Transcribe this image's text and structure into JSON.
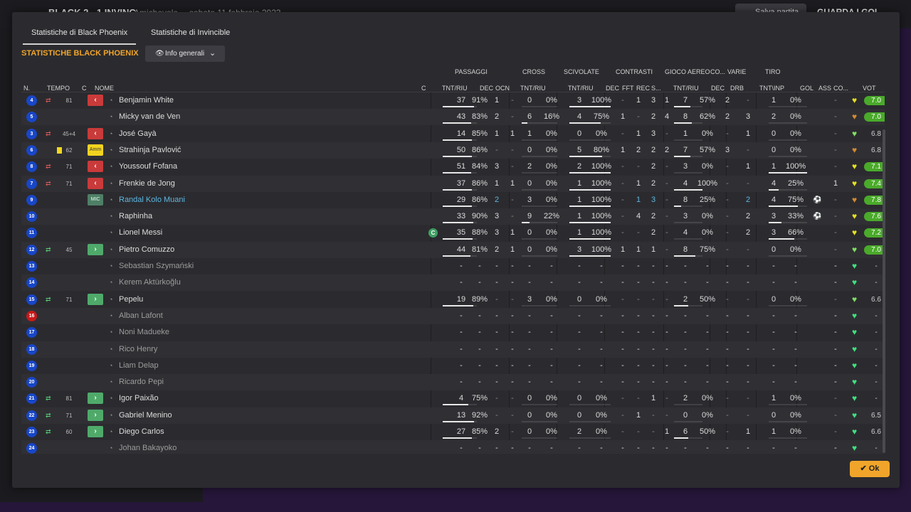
{
  "background": {
    "back": "←",
    "match": "BLACK  2 - 1  INVINC",
    "competition": "Amichevole",
    "date": "sabato 11 febbraio 2023",
    "save_label": "Salva partita",
    "watch_label": "GUARDA I GOL"
  },
  "tabs": [
    "Statistiche di Black Phoenix",
    "Statistiche di Invincible"
  ],
  "team_title": "STATISTICHE BLACK PHOENIX",
  "dropdown": {
    "label": "Info generali",
    "eye": "👁",
    "chevron": "⌄"
  },
  "groups": {
    "passaggi": "PASSAGGI",
    "cross": "CROSS",
    "scivolate": "SCIVOLATE",
    "contrasti": "CONTRASTI",
    "gioco_aereo": "GIOCO AEREO",
    "co": "CO...",
    "varie": "VARIE",
    "tiro": "TIRO"
  },
  "columns": {
    "n": "N.",
    "tempo": "TEMPO",
    "c": "C",
    "nome": "NOME",
    "c2": "C",
    "pass_tnt": "TNT/RIU",
    "pass_dec": "DEC",
    "pass_ocn": "OCN",
    "cross_tnt": "TNT/RIU",
    "sciv_tnt": "TNT/RIU",
    "con_dec": "DEC",
    "con_fft": "FFT",
    "con_rec": "REC",
    "con_s": "S...",
    "aereo_tnt": "TNT/RIU",
    "co_dec": "DEC",
    "varie_drb": "DRB",
    "tiro_tnt": "TNT\\INP",
    "gol": "GOL",
    "ass": "ASS",
    "con2": "CO...",
    "vot": "VOT"
  },
  "icons": {
    "sub_out": "⇄",
    "sub_in": "⇄",
    "out_badge": "‹",
    "in_badge": "›",
    "head": "◔",
    "heart": "♥",
    "gol": "⚽",
    "captain": "C"
  },
  "players": [
    {
      "n": "4",
      "num_color": "blue",
      "sub": "out",
      "min": "81",
      "badge": "out",
      "name": "Benjamin White",
      "style": "",
      "p": "37",
      "pp": "91%",
      "pbar": 0.91,
      "pd": "1",
      "po": "-",
      "c": "0",
      "cp": "0%",
      "cbar": 0,
      "s": "3",
      "sp": "100%",
      "sbar": 1,
      "k1": "-",
      "k2": "1",
      "k3": "3",
      "k4": "1",
      "a": "7",
      "ap": "57%",
      "abar": 0.57,
      "cd": "2",
      "dr": "-",
      "t": "1",
      "tp": "0%",
      "tbar": 0,
      "gol": "",
      "as": "-",
      "heart": "#e6e020",
      "vot": "7.0",
      "vg": true
    },
    {
      "n": "5",
      "num_color": "blue",
      "sub": "",
      "min": "",
      "badge": "",
      "name": "Micky van de Ven",
      "style": "",
      "p": "43",
      "pp": "83%",
      "pbar": 0.83,
      "pd": "2",
      "po": "-",
      "c": "6",
      "cp": "16%",
      "cbar": 0.16,
      "s": "4",
      "sp": "75%",
      "sbar": 0.75,
      "k1": "1",
      "k2": "-",
      "k3": "2",
      "k4": "4",
      "a": "8",
      "ap": "62%",
      "abar": 0.62,
      "cd": "2",
      "dr": "3",
      "t": "2",
      "tp": "0%",
      "tbar": 0,
      "gol": "",
      "as": "-",
      "heart": "#d48a30",
      "vot": "7.0",
      "vg": true
    },
    {
      "n": "3",
      "num_color": "blue",
      "sub": "out",
      "min": "45+4",
      "badge": "out",
      "name": "José Gayà",
      "style": "",
      "p": "14",
      "pp": "85%",
      "pbar": 0.85,
      "pd": "1",
      "po": "1",
      "c": "1",
      "cp": "0%",
      "cbar": 0,
      "s": "0",
      "sp": "0%",
      "sbar": 0,
      "k1": "-",
      "k2": "1",
      "k3": "3",
      "k4": "-",
      "a": "1",
      "ap": "0%",
      "abar": 0,
      "cd": "-",
      "dr": "1",
      "t": "0",
      "tp": "0%",
      "tbar": 0,
      "gol": "",
      "as": "-",
      "heart": "#7ee060",
      "vot": "6.8",
      "vg": false
    },
    {
      "n": "6",
      "num_color": "blue",
      "sub": "yellow",
      "min": "62",
      "badge": "amm",
      "name": "Strahinja Pavlović",
      "style": "",
      "p": "50",
      "pp": "86%",
      "pbar": 0.86,
      "pd": "-",
      "po": "-",
      "c": "0",
      "cp": "0%",
      "cbar": 0,
      "s": "5",
      "sp": "80%",
      "sbar": 0.8,
      "k1": "1",
      "k2": "2",
      "k3": "2",
      "k4": "2",
      "a": "7",
      "ap": "57%",
      "abar": 0.57,
      "cd": "3",
      "dr": "-",
      "t": "0",
      "tp": "0%",
      "tbar": 0,
      "gol": "",
      "as": "-",
      "heart": "#d48a30",
      "vot": "6.8",
      "vg": false
    },
    {
      "n": "8",
      "num_color": "blue",
      "sub": "out",
      "min": "71",
      "badge": "out",
      "name": "Youssouf Fofana",
      "style": "",
      "p": "51",
      "pp": "84%",
      "pbar": 0.84,
      "pd": "3",
      "po": "-",
      "c": "2",
      "cp": "0%",
      "cbar": 0,
      "s": "2",
      "sp": "100%",
      "sbar": 1,
      "k1": "-",
      "k2": "-",
      "k3": "2",
      "k4": "-",
      "a": "3",
      "ap": "0%",
      "abar": 0,
      "cd": "-",
      "dr": "1",
      "t": "1",
      "tp": "100%",
      "tbar": 1,
      "gol": "",
      "as": "-",
      "heart": "#e6e020",
      "vot": "7.1",
      "vg": true
    },
    {
      "n": "7",
      "num_color": "blue",
      "sub": "out",
      "min": "71",
      "badge": "out",
      "name": "Frenkie de Jong",
      "style": "",
      "p": "37",
      "pp": "86%",
      "pbar": 0.86,
      "pd": "1",
      "po": "1",
      "c": "0",
      "cp": "0%",
      "cbar": 0,
      "s": "1",
      "sp": "100%",
      "sbar": 1,
      "k1": "-",
      "k2": "1",
      "k3": "2",
      "k4": "-",
      "a": "4",
      "ap": "100%",
      "abar": 1,
      "cd": "-",
      "dr": "-",
      "t": "4",
      "tp": "25%",
      "tbar": 0.25,
      "gol": "",
      "as": "1",
      "heart": "#e6e020",
      "vot": "7.4",
      "vg": true
    },
    {
      "n": "9",
      "num_color": "blue",
      "sub": "",
      "min": "",
      "badge": "mic",
      "name": "Randal Kolo Muani",
      "style": "hl",
      "p": "29",
      "pp": "86%",
      "pbar": 0.86,
      "pd": "2",
      "po": "-",
      "c": "3",
      "cp": "0%",
      "cbar": 0,
      "s": "1",
      "sp": "100%",
      "sbar": 1,
      "k1": "-",
      "k2": "1",
      "k3": "3",
      "k4": "-",
      "a": "8",
      "ap": "25%",
      "abar": 0.25,
      "cd": "-",
      "dr": "2",
      "t": "4",
      "tp": "75%",
      "tbar": 0.75,
      "gol": "⚽",
      "as": "-",
      "heart": "#d48a30",
      "vot": "7.8",
      "vg": true
    },
    {
      "n": "10",
      "num_color": "blue",
      "sub": "",
      "min": "",
      "badge": "",
      "name": "Raphinha",
      "style": "",
      "p": "33",
      "pp": "90%",
      "pbar": 0.9,
      "pd": "3",
      "po": "-",
      "c": "9",
      "cp": "22%",
      "cbar": 0.22,
      "s": "1",
      "sp": "100%",
      "sbar": 1,
      "k1": "-",
      "k2": "4",
      "k3": "2",
      "k4": "-",
      "a": "3",
      "ap": "0%",
      "abar": 0,
      "cd": "-",
      "dr": "2",
      "t": "3",
      "tp": "33%",
      "tbar": 0.33,
      "gol": "⚽",
      "as": "-",
      "heart": "#e6e020",
      "vot": "7.6",
      "vg": true
    },
    {
      "n": "11",
      "num_color": "blue",
      "sub": "",
      "min": "",
      "badge": "",
      "name": "Lionel Messi",
      "style": "",
      "captain": true,
      "p": "35",
      "pp": "88%",
      "pbar": 0.88,
      "pd": "3",
      "po": "1",
      "c": "0",
      "cp": "0%",
      "cbar": 0,
      "s": "1",
      "sp": "100%",
      "sbar": 1,
      "k1": "-",
      "k2": "-",
      "k3": "2",
      "k4": "-",
      "a": "4",
      "ap": "0%",
      "abar": 0,
      "cd": "-",
      "dr": "2",
      "t": "3",
      "tp": "66%",
      "tbar": 0.66,
      "gol": "",
      "as": "-",
      "heart": "#e6e020",
      "vot": "7.2",
      "vg": true
    },
    {
      "n": "12",
      "num_color": "blue",
      "sub": "in",
      "min": "45",
      "badge": "in",
      "name": "Pietro Comuzzo",
      "style": "",
      "p": "44",
      "pp": "81%",
      "pbar": 0.81,
      "pd": "2",
      "po": "1",
      "c": "0",
      "cp": "0%",
      "cbar": 0,
      "s": "3",
      "sp": "100%",
      "sbar": 1,
      "k1": "1",
      "k2": "1",
      "k3": "1",
      "k4": "-",
      "a": "8",
      "ap": "75%",
      "abar": 0.75,
      "cd": "-",
      "dr": "-",
      "t": "0",
      "tp": "0%",
      "tbar": 0,
      "gol": "",
      "as": "-",
      "heart": "#7ee060",
      "vot": "7.0",
      "vg": true
    },
    {
      "n": "13",
      "num_color": "blue",
      "sub": "",
      "min": "",
      "badge": "",
      "name": "Sebastian Szymański",
      "style": "dim",
      "empty": true,
      "heart": "#3fe080",
      "vot": "-",
      "vg": false
    },
    {
      "n": "14",
      "num_color": "blue",
      "sub": "",
      "min": "",
      "badge": "",
      "name": "Kerem Aktürkoğlu",
      "style": "dim",
      "empty": true,
      "heart": "#3fe080",
      "vot": "-",
      "vg": false
    },
    {
      "n": "15",
      "num_color": "blue",
      "sub": "in",
      "min": "71",
      "badge": "in",
      "name": "Pepelu",
      "style": "",
      "p": "19",
      "pp": "89%",
      "pbar": 0.89,
      "pd": "-",
      "po": "-",
      "c": "3",
      "cp": "0%",
      "cbar": 0,
      "s": "0",
      "sp": "0%",
      "sbar": 0,
      "k1": "-",
      "k2": "-",
      "k3": "-",
      "k4": "-",
      "a": "2",
      "ap": "50%",
      "abar": 0.5,
      "cd": "-",
      "dr": "-",
      "t": "0",
      "tp": "0%",
      "tbar": 0,
      "gol": "",
      "as": "-",
      "heart": "#7ee060",
      "vot": "6.6",
      "vg": false
    },
    {
      "n": "16",
      "num_color": "red",
      "sub": "",
      "min": "",
      "badge": "",
      "name": "Alban Lafont",
      "style": "dim",
      "empty": true,
      "heart": "#3fe080",
      "vot": "-",
      "vg": false
    },
    {
      "n": "17",
      "num_color": "blue",
      "sub": "",
      "min": "",
      "badge": "",
      "name": "Noni Madueke",
      "style": "dim",
      "empty": true,
      "heart": "#3fe080",
      "vot": "-",
      "vg": false
    },
    {
      "n": "18",
      "num_color": "blue",
      "sub": "",
      "min": "",
      "badge": "",
      "name": "Rico Henry",
      "style": "dim",
      "empty": true,
      "heart": "#3fe080",
      "vot": "-",
      "vg": false
    },
    {
      "n": "19",
      "num_color": "blue",
      "sub": "",
      "min": "",
      "badge": "",
      "name": "Liam Delap",
      "style": "dim",
      "empty": true,
      "heart": "#3fe080",
      "vot": "-",
      "vg": false
    },
    {
      "n": "20",
      "num_color": "blue",
      "sub": "",
      "min": "",
      "badge": "",
      "name": "Ricardo Pepi",
      "style": "dim",
      "empty": true,
      "heart": "#3fe080",
      "vot": "-",
      "vg": false
    },
    {
      "n": "21",
      "num_color": "blue",
      "sub": "in",
      "min": "81",
      "badge": "in",
      "name": "Igor Paixão",
      "style": "",
      "p": "4",
      "pp": "75%",
      "pbar": 0.75,
      "pd": "-",
      "po": "-",
      "c": "0",
      "cp": "0%",
      "cbar": 0,
      "s": "0",
      "sp": "0%",
      "sbar": 0,
      "k1": "-",
      "k2": "-",
      "k3": "1",
      "k4": "-",
      "a": "2",
      "ap": "0%",
      "abar": 0,
      "cd": "-",
      "dr": "-",
      "t": "1",
      "tp": "0%",
      "tbar": 0,
      "gol": "",
      "as": "-",
      "heart": "#3fe080",
      "vot": "-",
      "vg": false
    },
    {
      "n": "22",
      "num_color": "blue",
      "sub": "in",
      "min": "71",
      "badge": "in",
      "name": "Gabriel Menino",
      "style": "",
      "p": "13",
      "pp": "92%",
      "pbar": 0.92,
      "pd": "-",
      "po": "-",
      "c": "0",
      "cp": "0%",
      "cbar": 0,
      "s": "0",
      "sp": "0%",
      "sbar": 0,
      "k1": "-",
      "k2": "1",
      "k3": "-",
      "k4": "-",
      "a": "0",
      "ap": "0%",
      "abar": 0,
      "cd": "-",
      "dr": "-",
      "t": "0",
      "tp": "0%",
      "tbar": 0,
      "gol": "",
      "as": "-",
      "heart": "#3fe080",
      "vot": "6.5",
      "vg": false
    },
    {
      "n": "23",
      "num_color": "blue",
      "sub": "in",
      "min": "60",
      "badge": "in",
      "name": "Diego Carlos",
      "style": "",
      "p": "27",
      "pp": "85%",
      "pbar": 0.85,
      "pd": "2",
      "po": "-",
      "c": "0",
      "cp": "0%",
      "cbar": 0,
      "s": "2",
      "sp": "0%",
      "sbar": 0,
      "k1": "-",
      "k2": "-",
      "k3": "-",
      "k4": "1",
      "a": "6",
      "ap": "50%",
      "abar": 0.5,
      "cd": "-",
      "dr": "1",
      "t": "1",
      "tp": "0%",
      "tbar": 0,
      "gol": "",
      "as": "-",
      "heart": "#3fe080",
      "vot": "6.6",
      "vg": false
    },
    {
      "n": "24",
      "num_color": "blue",
      "sub": "",
      "min": "",
      "badge": "",
      "name": "Johan Bakayoko",
      "style": "dim",
      "empty": true,
      "heart": "#3fe080",
      "vot": "-",
      "vg": false
    }
  ],
  "badge_labels": {
    "out": "‹",
    "in": "›",
    "amm": "Amm",
    "mic": "MIC"
  },
  "ok_label": "✔ Ok"
}
